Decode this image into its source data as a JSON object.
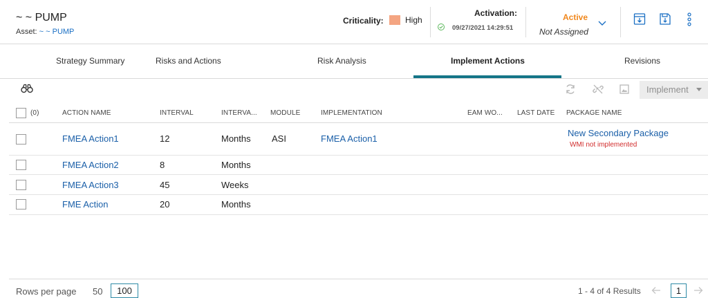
{
  "header": {
    "title": "~ ~ PUMP",
    "asset_label": "Asset:",
    "asset_link": "~ ~ PUMP",
    "criticality_label": "Criticality:",
    "criticality_value": "High",
    "criticality_color": "#f4a582",
    "activation_label": "Activation:",
    "activation_date": "09/27/2021 14:29:51",
    "status": "Active",
    "status_color": "#f0871c",
    "assignment": "Not Assigned",
    "icons": [
      "chevron-down-icon",
      "download-icon",
      "save-icon",
      "more-vertical-icon"
    ]
  },
  "tabs": [
    {
      "label": "Strategy Summary",
      "active": false
    },
    {
      "label": "Risks and Actions",
      "active": false
    },
    {
      "label": "Risk Analysis",
      "active": false
    },
    {
      "label": "Implement Actions",
      "active": true
    },
    {
      "label": "Revisions",
      "active": false
    }
  ],
  "accent_color": "#147587",
  "toolbar": {
    "icons": [
      "binoculars-icon",
      "refresh-icon",
      "unlink-icon",
      "image-icon"
    ],
    "implement_label": "Implement"
  },
  "grid": {
    "selected_count": "(0)",
    "columns": [
      "ACTION NAME",
      "INTERVAL",
      "INTERVA...",
      "MODULE",
      "IMPLEMENTATION",
      "EAM WO...",
      "LAST DATE",
      "PACKAGE NAME"
    ],
    "rows": [
      {
        "action": "FMEA Action1",
        "interval": "12",
        "unit": "Months",
        "module": "ASI",
        "implementation": "FMEA Action1",
        "package": "New Secondary Package",
        "warning": "WMI not implemented"
      },
      {
        "action": "FMEA Action2",
        "interval": "8",
        "unit": "Months",
        "module": "",
        "implementation": "",
        "package": "",
        "warning": ""
      },
      {
        "action": "FMEA Action3",
        "interval": "45",
        "unit": "Weeks",
        "module": "",
        "implementation": "",
        "package": "",
        "warning": ""
      },
      {
        "action": "FME Action",
        "interval": "20",
        "unit": "Months",
        "module": "",
        "implementation": "",
        "package": "",
        "warning": ""
      }
    ]
  },
  "footer": {
    "rows_per_page_label": "Rows per page",
    "page_size_options": [
      "50",
      "100"
    ],
    "selected_page_size": "100",
    "results": "1 - 4 of 4 Results",
    "current_page": "1"
  }
}
